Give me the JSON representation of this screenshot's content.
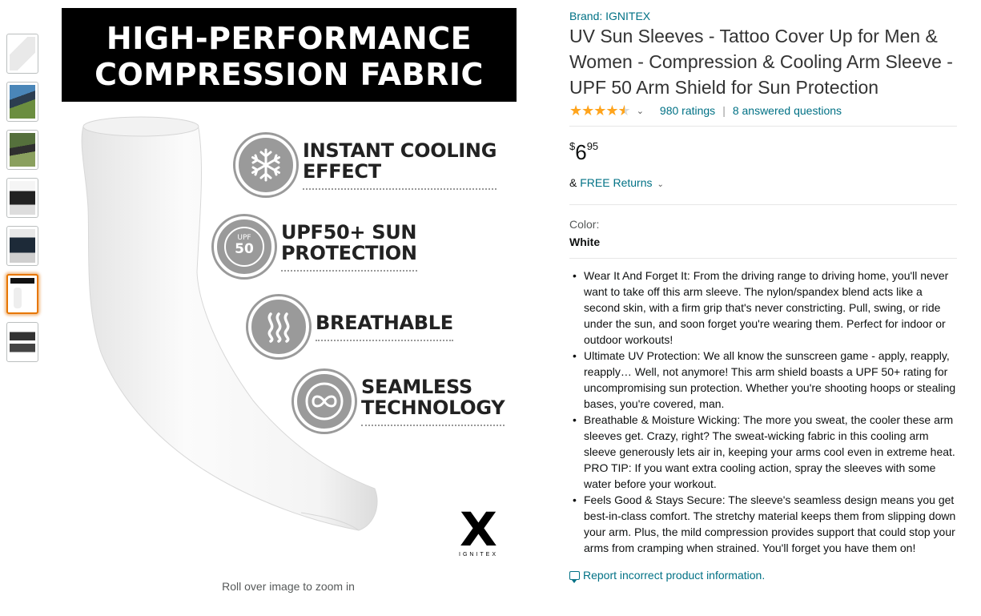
{
  "thumbnails": [
    {
      "icon": "sleeve-product-thumb"
    },
    {
      "icon": "lifestyle-photo-thumb"
    },
    {
      "icon": "golf-photo-thumb"
    },
    {
      "icon": "tattoo-photo-thumb"
    },
    {
      "icon": "model-photo-thumb"
    },
    {
      "icon": "infographic-thumb",
      "selected": true
    },
    {
      "icon": "package-thumb"
    }
  ],
  "main_image": {
    "banner_line1": "HIGH-PERFORMANCE",
    "banner_line2": "COMPRESSION FABRIC",
    "features": [
      {
        "line1": "INSTANT COOLING",
        "line2": "EFFECT",
        "icon": "snowflake-icon"
      },
      {
        "line1": "UPF50+ SUN",
        "line2": "PROTECTION",
        "icon": "upf-badge-icon"
      },
      {
        "line1": "BREATHABLE",
        "line2": "",
        "icon": "heat-waves-icon"
      },
      {
        "line1": "SEAMLESS",
        "line2": "TECHNOLOGY",
        "icon": "infinity-icon"
      }
    ],
    "upf_label": "UPF",
    "upf_value": "50",
    "logo_mark": "X",
    "logo_text": "IGNITEX",
    "zoom_hint": "Roll over image to zoom in"
  },
  "product": {
    "brand": "Brand: IGNITEX",
    "title": "UV Sun Sleeves - Tattoo Cover Up for Men & Women - Compression & Cooling Arm Sleeve - UPF 50 Arm Shield for Sun Protection",
    "rating_stars": 4.5,
    "ratings": "980 ratings",
    "separator": "|",
    "questions": "8 answered questions",
    "price_symbol": "$",
    "price_whole": "6",
    "price_fraction": "95",
    "returns_prefix": "& ",
    "returns_link": "FREE Returns",
    "color_label": "Color:",
    "color_value": "White",
    "bullets": [
      "Wear It And Forget It: From the driving range to driving home, you'll never want to take off this arm sleeve. The nylon/spandex blend acts like a second skin, with a firm grip that's never constricting. Pull, swing, or ride under the sun, and soon forget you're wearing them. Perfect for indoor or outdoor workouts!",
      "Ultimate UV Protection: We all know the sunscreen game - apply, reapply, reapply… Well, not anymore! This arm shield boasts a UPF 50+ rating for uncompromising sun protection. Whether you're shooting hoops or stealing bases, you're covered, man.",
      "Breathable & Moisture Wicking: The more you sweat, the cooler these arm sleeves get. Crazy, right? The sweat-wicking fabric in this cooling arm sleeve generously lets air in, keeping your arms cool even in extreme heat. PRO TIP: If you want extra cooling action, spray the sleeves with some water before your workout.",
      "Feels Good & Stays Secure: The sleeve's seamless design means you get best-in-class comfort. The stretchy material keeps them from slipping down your arm. Plus, the mild compression provides support that could stop your arms from cramping when strained. You'll forget you have them on!"
    ],
    "report_link": "Report incorrect product information."
  },
  "colors": {
    "link": "#007185",
    "star": "#ffa41c",
    "selected_thumb": "#e77600"
  }
}
